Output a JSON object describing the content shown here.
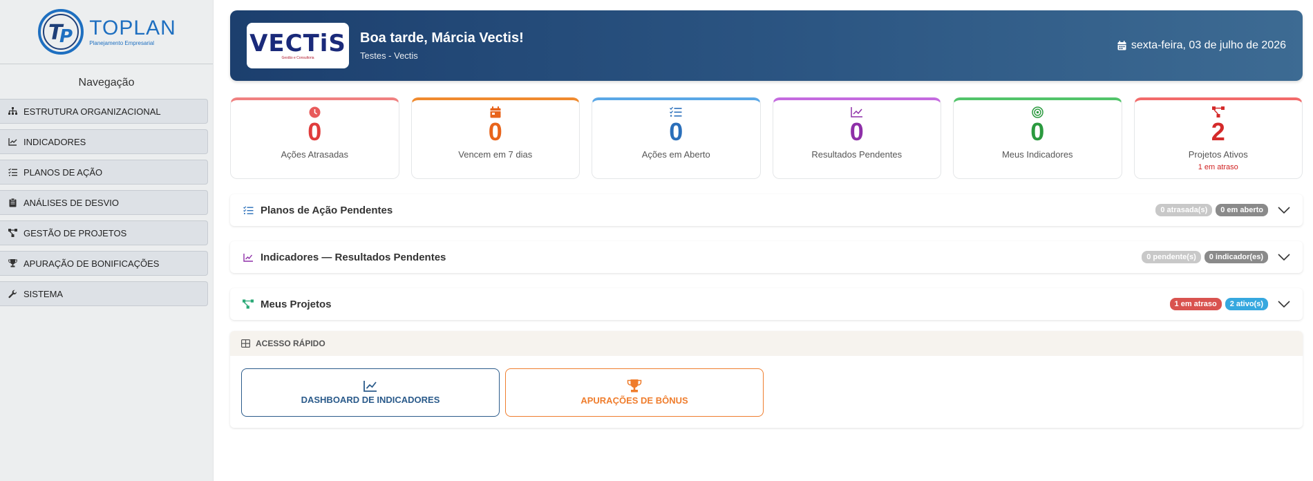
{
  "brand": {
    "name": "TOPLAN",
    "tagline": "Planejamento Empresarial",
    "color": "#1e6fc0"
  },
  "sidebar": {
    "title": "Navegação",
    "items": [
      {
        "label": "ESTRUTURA ORGANIZACIONAL",
        "icon": "sitemap-icon"
      },
      {
        "label": "INDICADORES",
        "icon": "line-chart-icon"
      },
      {
        "label": "PLANOS DE AÇÃO",
        "icon": "list-check-icon"
      },
      {
        "label": "ANÁLISES DE DESVIO",
        "icon": "clipboard-icon"
      },
      {
        "label": "GESTÃO DE PROJETOS",
        "icon": "diagram-icon"
      },
      {
        "label": "APURAÇÃO DE BONIFICAÇÕES",
        "icon": "trophy-icon"
      },
      {
        "label": "SISTEMA",
        "icon": "wrench-icon"
      }
    ]
  },
  "header": {
    "company_logo": {
      "name": "VECTiS",
      "sub": "Gestão e Consultoria"
    },
    "greeting": "Boa tarde, Márcia Vectis!",
    "company": "Testes - Vectis",
    "date": "sexta-feira, 03 de julho de 2026"
  },
  "stats": [
    {
      "value": "0",
      "label": "Ações Atrasadas",
      "color": "#e03c3c",
      "accent": "#f08080",
      "icon": "clock-icon"
    },
    {
      "value": "0",
      "label": "Vencem em 7 dias",
      "color": "#e8641b",
      "accent": "#f08a2e",
      "icon": "calendar-icon"
    },
    {
      "value": "0",
      "label": "Ações em Aberto",
      "color": "#2a6fba",
      "accent": "#5aa7e6",
      "icon": "task-list-icon"
    },
    {
      "value": "0",
      "label": "Resultados Pendentes",
      "color": "#8e2fa8",
      "accent": "#c46adf",
      "icon": "chart-line-icon"
    },
    {
      "value": "0",
      "label": "Meus Indicadores",
      "color": "#2b9a3f",
      "accent": "#52c46a",
      "icon": "target-icon"
    },
    {
      "value": "2",
      "label": "Projetos Ativos",
      "note": "1 em atraso",
      "color": "#d42a2a",
      "accent": "#f26a6a",
      "icon": "project-diagram-icon"
    }
  ],
  "sections": [
    {
      "title": "Planos de Ação Pendentes",
      "icon": "list-check-icon",
      "icon_color": "#2a6fba",
      "badges": [
        {
          "text": "0 atrasada(s)",
          "color": "#c8c8c8"
        },
        {
          "text": "0 em aberto",
          "color": "#8a8a8a"
        }
      ]
    },
    {
      "title": "Indicadores — Resultados Pendentes",
      "icon": "line-chart-icon",
      "icon_color": "#8e2fa8",
      "badges": [
        {
          "text": "0 pendente(s)",
          "color": "#c8c8c8"
        },
        {
          "text": "0 indicador(es)",
          "color": "#8a8a8a"
        }
      ]
    },
    {
      "title": "Meus Projetos",
      "icon": "project-diagram-icon",
      "icon_color": "#2aa876",
      "badges": [
        {
          "text": "1 em atraso",
          "color": "#d9534f"
        },
        {
          "text": "2 ativo(s)",
          "color": "#36a8df"
        }
      ]
    }
  ],
  "quick_access": {
    "title": "ACESSO RÁPIDO",
    "buttons": [
      {
        "label": "DASHBOARD DE INDICADORES",
        "icon": "chart-line-icon"
      },
      {
        "label": "APURAÇÕES DE BÔNUS",
        "icon": "trophy-icon"
      }
    ]
  }
}
